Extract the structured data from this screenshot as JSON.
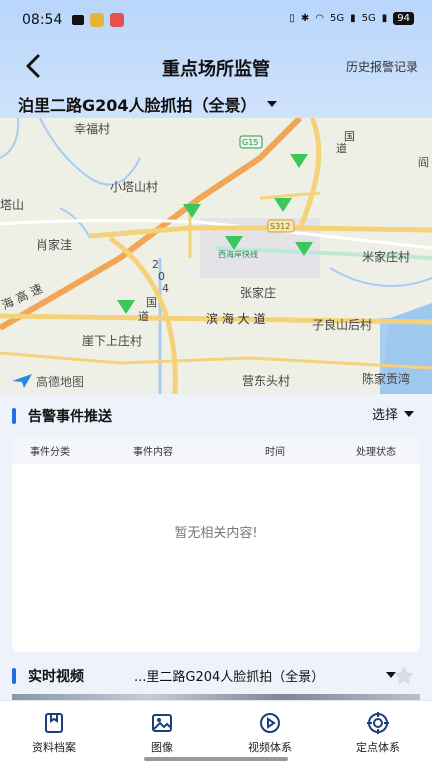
{
  "status_bar": {
    "time": "08:54",
    "battery": "94",
    "signal_1": "5G",
    "signal_2": "5G"
  },
  "nav": {
    "title": "重点场所监管",
    "history": "历史报警记录"
  },
  "location": {
    "selected": "泊里二路G204人脸抓拍（全景）"
  },
  "map": {
    "labels": [
      "幸福村",
      "小塔山村",
      "塔山",
      "肖家洼",
      "米家庄村",
      "张家庄",
      "滨 海 大 道",
      "子良山后村",
      "崖下上庄村",
      "营东头村",
      "陈家贡湾",
      "海 高 速",
      "西海岸快线",
      "G15",
      "S312",
      "2",
      "0",
      "4",
      "国",
      "道",
      "国",
      "道",
      "阎",
      "高德地图"
    ]
  },
  "alerts": {
    "title": "告警事件推送",
    "select_label": "选择",
    "columns": [
      "事件分类",
      "事件内容",
      "时间",
      "处理状态"
    ],
    "empty": "暂无相关内容!"
  },
  "video": {
    "title": "实时视频",
    "location": "...里二路G204人脸抓拍（全景）"
  },
  "tabs": [
    {
      "label": "资料档案",
      "icon": "archive-icon"
    },
    {
      "label": "图像",
      "icon": "image-icon"
    },
    {
      "label": "视频体系",
      "icon": "video-icon"
    },
    {
      "label": "定点体系",
      "icon": "target-icon"
    }
  ],
  "colors": {
    "accent": "#1f6fe0",
    "header": "#b8d6fb",
    "marker": "#3cc75b"
  }
}
